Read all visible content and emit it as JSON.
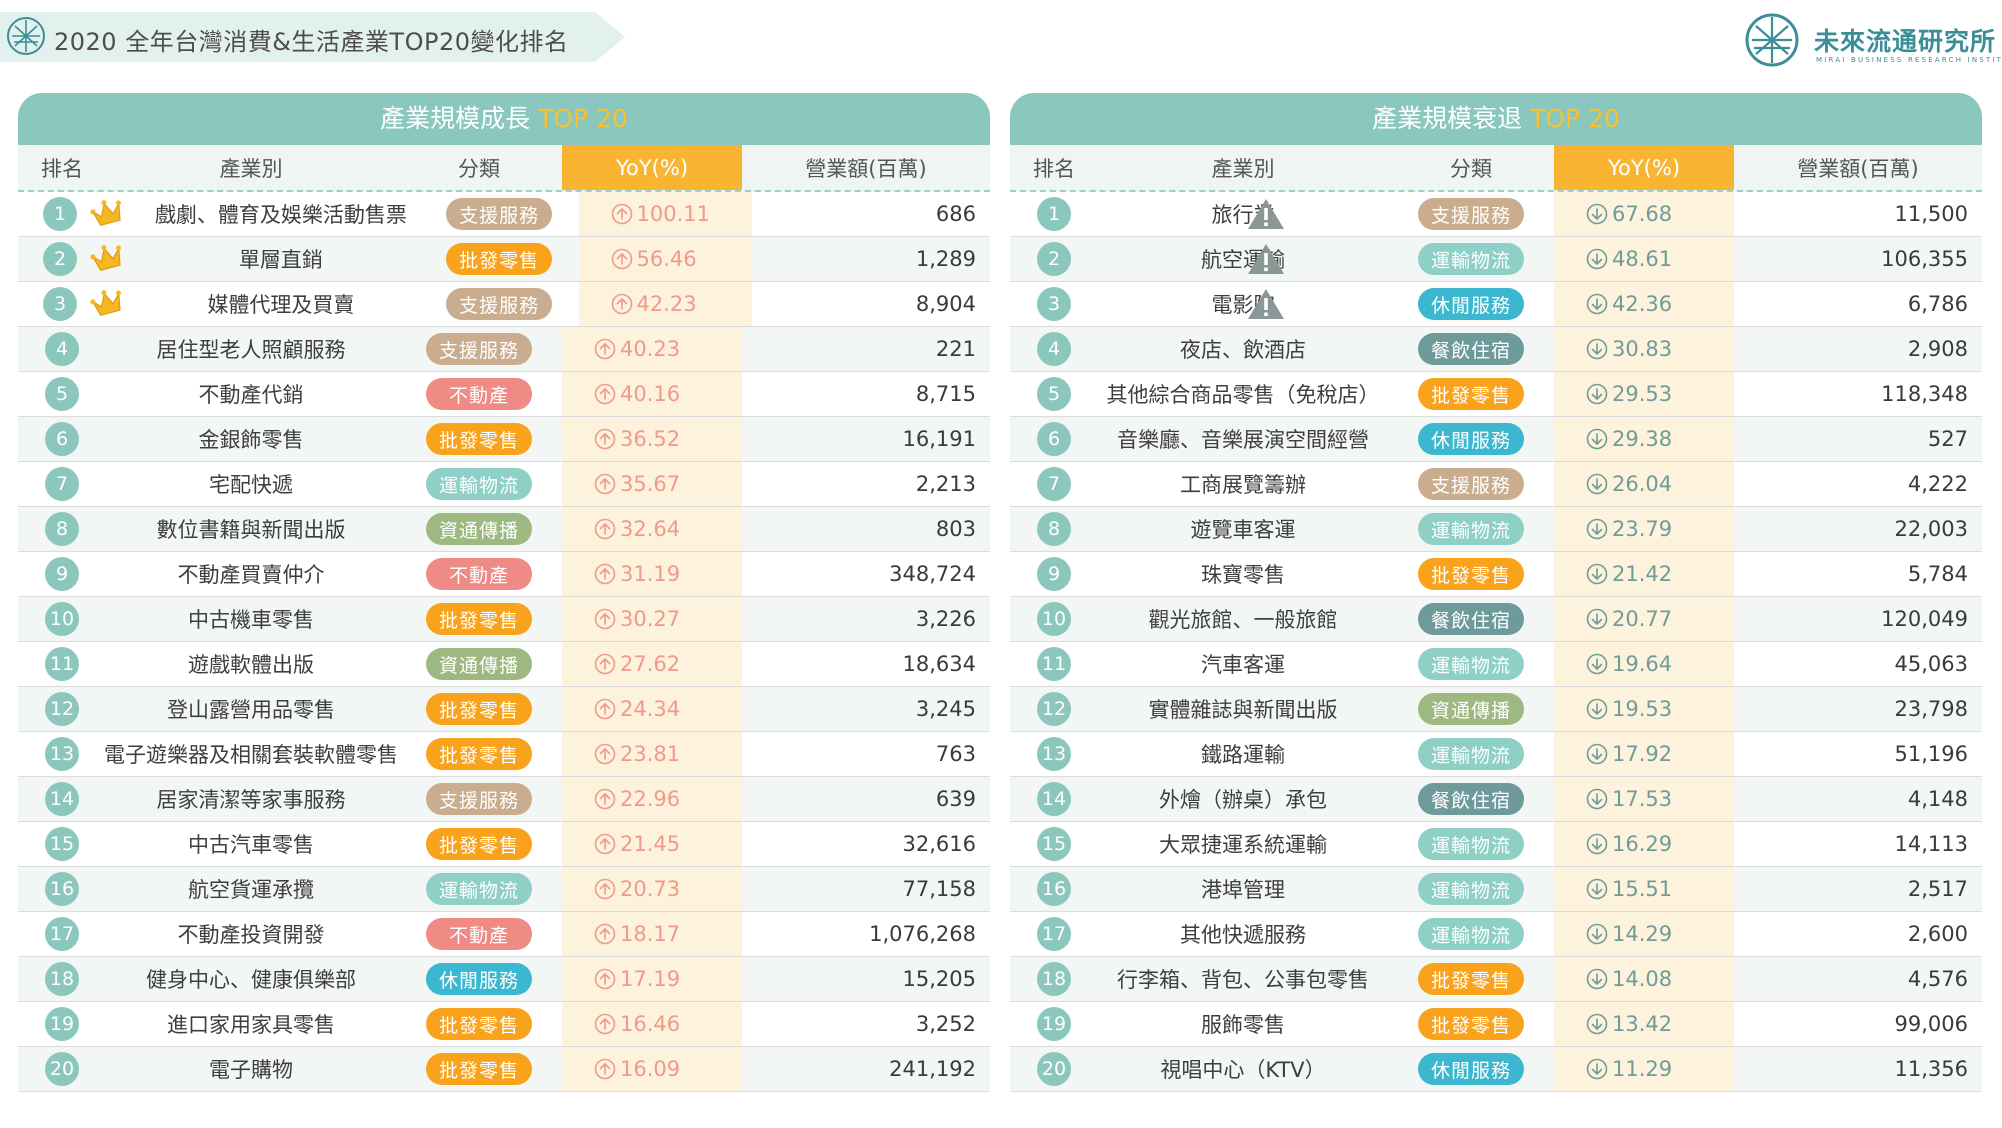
{
  "header": {
    "title": "2020 全年台灣消費&生活產業TOP20變化排名",
    "brand_name": "未來流通研究所",
    "brand_sub": "MIRAI BUSINESS RESEARCH INSTITUTE"
  },
  "colors": {
    "teal": "#8ac7bf",
    "yoy_header": "#f9b531",
    "up": "#ef9a8c",
    "down": "#6f9c9a",
    "badge": {
      "支援服務": "#c9ad8e",
      "批發零售": "#f9a21b",
      "不動產": "#ef8a84",
      "運輸物流": "#8ed0c6",
      "資通傳播": "#9db881",
      "休閒服務": "#3bb8d0",
      "餐飲住宿": "#6f9a9c"
    }
  },
  "icons": {
    "up": "arrow-up-circle-icon",
    "down": "arrow-down-circle-icon",
    "crown": "crown-icon",
    "warning": "warning-triangle-icon"
  },
  "columns": {
    "rank": "排名",
    "name": "產業別",
    "category": "分類",
    "yoy": "YoY(%)",
    "revenue": "營業額(百萬)"
  },
  "growth": {
    "title_prefix": "產業規模成長",
    "title_highlight": "TOP 20",
    "rows": [
      {
        "rank": "1",
        "name": "戲劇、體育及娛樂活動售票",
        "category": "支援服務",
        "yoy": "100.11",
        "revenue": "686"
      },
      {
        "rank": "2",
        "name": "單層直銷",
        "category": "批發零售",
        "yoy": "56.46",
        "revenue": "1,289"
      },
      {
        "rank": "3",
        "name": "媒體代理及買賣",
        "category": "支援服務",
        "yoy": "42.23",
        "revenue": "8,904"
      },
      {
        "rank": "4",
        "name": "居住型老人照顧服務",
        "category": "支援服務",
        "yoy": "40.23",
        "revenue": "221"
      },
      {
        "rank": "5",
        "name": "不動產代銷",
        "category": "不動產",
        "yoy": "40.16",
        "revenue": "8,715"
      },
      {
        "rank": "6",
        "name": "金銀飾零售",
        "category": "批發零售",
        "yoy": "36.52",
        "revenue": "16,191"
      },
      {
        "rank": "7",
        "name": "宅配快遞",
        "category": "運輸物流",
        "yoy": "35.67",
        "revenue": "2,213"
      },
      {
        "rank": "8",
        "name": "數位書籍與新聞出版",
        "category": "資通傳播",
        "yoy": "32.64",
        "revenue": "803"
      },
      {
        "rank": "9",
        "name": "不動產買賣仲介",
        "category": "不動產",
        "yoy": "31.19",
        "revenue": "348,724"
      },
      {
        "rank": "10",
        "name": "中古機車零售",
        "category": "批發零售",
        "yoy": "30.27",
        "revenue": "3,226"
      },
      {
        "rank": "11",
        "name": "遊戲軟體出版",
        "category": "資通傳播",
        "yoy": "27.62",
        "revenue": "18,634"
      },
      {
        "rank": "12",
        "name": "登山露營用品零售",
        "category": "批發零售",
        "yoy": "24.34",
        "revenue": "3,245"
      },
      {
        "rank": "13",
        "name": "電子遊樂器及相關套裝軟體零售",
        "category": "批發零售",
        "yoy": "23.81",
        "revenue": "763"
      },
      {
        "rank": "14",
        "name": "居家清潔等家事服務",
        "category": "支援服務",
        "yoy": "22.96",
        "revenue": "639"
      },
      {
        "rank": "15",
        "name": "中古汽車零售",
        "category": "批發零售",
        "yoy": "21.45",
        "revenue": "32,616"
      },
      {
        "rank": "16",
        "name": "航空貨運承攬",
        "category": "運輸物流",
        "yoy": "20.73",
        "revenue": "77,158"
      },
      {
        "rank": "17",
        "name": "不動產投資開發",
        "category": "不動產",
        "yoy": "18.17",
        "revenue": "1,076,268"
      },
      {
        "rank": "18",
        "name": "健身中心、健康俱樂部",
        "category": "休閒服務",
        "yoy": "17.19",
        "revenue": "15,205"
      },
      {
        "rank": "19",
        "name": "進口家用家具零售",
        "category": "批發零售",
        "yoy": "16.46",
        "revenue": "3,252"
      },
      {
        "rank": "20",
        "name": "電子購物",
        "category": "批發零售",
        "yoy": "16.09",
        "revenue": "241,192"
      }
    ]
  },
  "decline": {
    "title_prefix": "產業規模衰退",
    "title_highlight": "TOP 20",
    "rows": [
      {
        "rank": "1",
        "name": "旅行業",
        "category": "支援服務",
        "yoy": "67.68",
        "revenue": "11,500"
      },
      {
        "rank": "2",
        "name": "航空運輸",
        "category": "運輸物流",
        "yoy": "48.61",
        "revenue": "106,355"
      },
      {
        "rank": "3",
        "name": "電影院",
        "category": "休閒服務",
        "yoy": "42.36",
        "revenue": "6,786"
      },
      {
        "rank": "4",
        "name": "夜店、飲酒店",
        "category": "餐飲住宿",
        "yoy": "30.83",
        "revenue": "2,908"
      },
      {
        "rank": "5",
        "name": "其他綜合商品零售（免稅店）",
        "category": "批發零售",
        "yoy": "29.53",
        "revenue": "118,348"
      },
      {
        "rank": "6",
        "name": "音樂廳、音樂展演空間經營",
        "category": "休閒服務",
        "yoy": "29.38",
        "revenue": "527"
      },
      {
        "rank": "7",
        "name": "工商展覽籌辦",
        "category": "支援服務",
        "yoy": "26.04",
        "revenue": "4,222"
      },
      {
        "rank": "8",
        "name": "遊覽車客運",
        "category": "運輸物流",
        "yoy": "23.79",
        "revenue": "22,003"
      },
      {
        "rank": "9",
        "name": "珠寶零售",
        "category": "批發零售",
        "yoy": "21.42",
        "revenue": "5,784"
      },
      {
        "rank": "10",
        "name": "觀光旅館、一般旅館",
        "category": "餐飲住宿",
        "yoy": "20.77",
        "revenue": "120,049"
      },
      {
        "rank": "11",
        "name": "汽車客運",
        "category": "運輸物流",
        "yoy": "19.64",
        "revenue": "45,063"
      },
      {
        "rank": "12",
        "name": "實體雜誌與新聞出版",
        "category": "資通傳播",
        "yoy": "19.53",
        "revenue": "23,798"
      },
      {
        "rank": "13",
        "name": "鐵路運輸",
        "category": "運輸物流",
        "yoy": "17.92",
        "revenue": "51,196"
      },
      {
        "rank": "14",
        "name": "外燴（辦桌）承包",
        "category": "餐飲住宿",
        "yoy": "17.53",
        "revenue": "4,148"
      },
      {
        "rank": "15",
        "name": "大眾捷運系統運輸",
        "category": "運輸物流",
        "yoy": "16.29",
        "revenue": "14,113"
      },
      {
        "rank": "16",
        "name": "港埠管理",
        "category": "運輸物流",
        "yoy": "15.51",
        "revenue": "2,517"
      },
      {
        "rank": "17",
        "name": "其他快遞服務",
        "category": "運輸物流",
        "yoy": "14.29",
        "revenue": "2,600"
      },
      {
        "rank": "18",
        "name": "行李箱、背包、公事包零售",
        "category": "批發零售",
        "yoy": "14.08",
        "revenue": "4,576"
      },
      {
        "rank": "19",
        "name": "服飾零售",
        "category": "批發零售",
        "yoy": "13.42",
        "revenue": "99,006"
      },
      {
        "rank": "20",
        "name": "視唱中心（KTV）",
        "category": "休閒服務",
        "yoy": "11.29",
        "revenue": "11,356"
      }
    ]
  }
}
